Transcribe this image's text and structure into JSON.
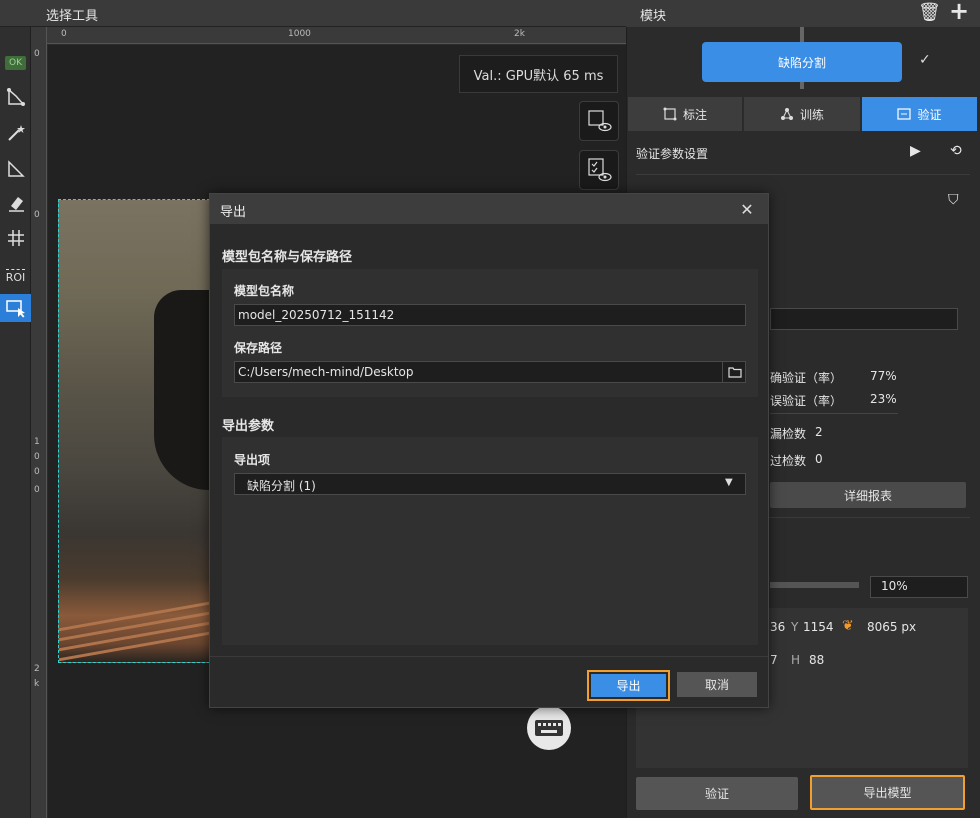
{
  "left_header": {
    "title": "选择工具"
  },
  "left_tools": {
    "ok_badge": "OK",
    "roi_label": "ROI"
  },
  "rulers": {
    "h_ticks": [
      "0",
      "1000",
      "2k"
    ],
    "v_ticks": [
      "0",
      "0",
      "1",
      "0",
      "0",
      "0",
      "2",
      "k"
    ]
  },
  "canvas": {
    "val_text": "Val.:  GPU默认 65 ms"
  },
  "right_panel": {
    "title": "模块",
    "module_button": "缺陷分割",
    "tabs": [
      {
        "label": "标注"
      },
      {
        "label": "训练"
      },
      {
        "label": "验证"
      }
    ],
    "validation_settings": "验证参数设置",
    "stats": {
      "correct_label": "确验证（率）",
      "correct_value": "77%",
      "wrong_label": "误验证（率）",
      "wrong_value": "23%",
      "missed_label": "漏检数",
      "missed_value": "2",
      "over_label": "过检数",
      "over_value": "0"
    },
    "report_button": "详细报表",
    "zoom_value": "10%",
    "coords": {
      "x_partial": "36",
      "y_label": "Y",
      "y_value": "1154",
      "px_value": "8065 px",
      "w_partial": "7",
      "h_label": "H",
      "h_value": "88"
    },
    "validate_button": "验证",
    "export_model_button": "导出模型"
  },
  "dialog": {
    "title": "导出",
    "section_name_path": "模型包名称与保存路径",
    "name_label": "模型包名称",
    "name_value": "model_20250712_151142",
    "path_label": "保存路径",
    "path_value": "C:/Users/mech-mind/Desktop",
    "section_params": "导出参数",
    "export_item_label": "导出项",
    "export_item_value": "缺陷分割 (1)",
    "export_button": "导出",
    "cancel_button": "取消"
  }
}
